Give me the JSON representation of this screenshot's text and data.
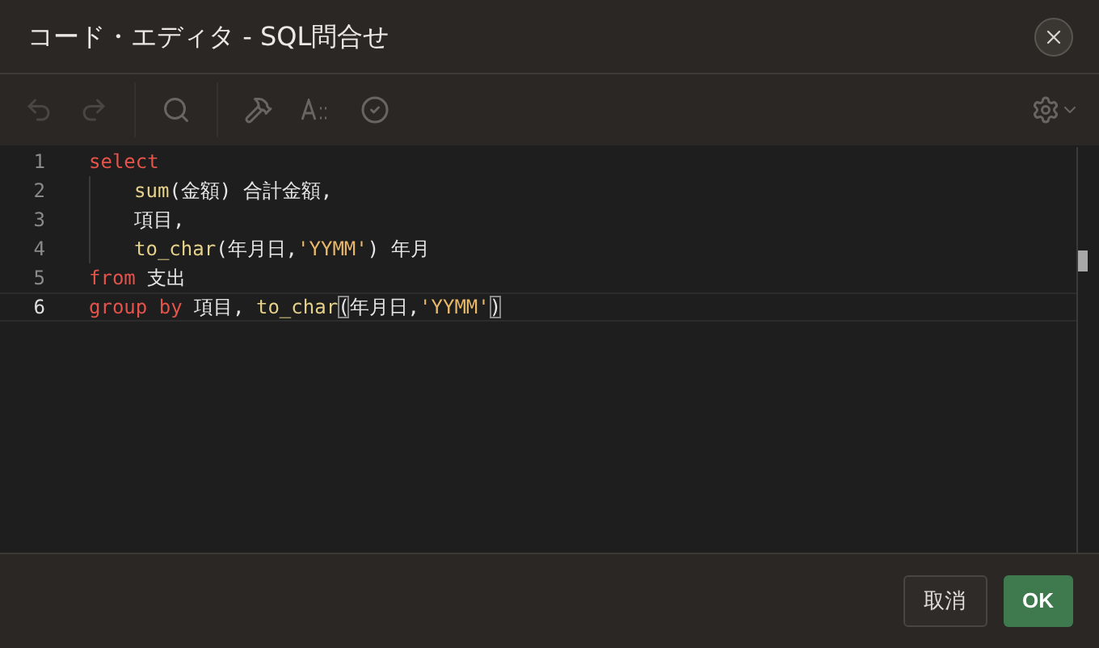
{
  "window": {
    "title": "コード・エディタ - SQL問合せ"
  },
  "toolbar": {
    "undo_disabled": true,
    "redo_disabled": true
  },
  "editor": {
    "lines": [
      {
        "number": "1",
        "active": false,
        "indent": false,
        "tokens": [
          {
            "kind": "keyword",
            "text": "select"
          }
        ]
      },
      {
        "number": "2",
        "active": false,
        "indent": true,
        "tokens": [
          {
            "kind": "function",
            "text": "sum"
          },
          {
            "kind": "plain",
            "text": "(金額) 合計金額,"
          }
        ]
      },
      {
        "number": "3",
        "active": false,
        "indent": true,
        "tokens": [
          {
            "kind": "plain",
            "text": "項目,"
          }
        ]
      },
      {
        "number": "4",
        "active": false,
        "indent": true,
        "tokens": [
          {
            "kind": "function",
            "text": "to_char"
          },
          {
            "kind": "plain",
            "text": "(年月日,"
          },
          {
            "kind": "string",
            "text": "'YYMM'"
          },
          {
            "kind": "plain",
            "text": ") 年月"
          }
        ]
      },
      {
        "number": "5",
        "active": false,
        "indent": false,
        "tokens": [
          {
            "kind": "keyword",
            "text": "from"
          },
          {
            "kind": "plain",
            "text": " 支出"
          }
        ]
      },
      {
        "number": "6",
        "active": true,
        "indent": false,
        "tokens": [
          {
            "kind": "keyword",
            "text": "group by"
          },
          {
            "kind": "plain",
            "text": " 項目, "
          },
          {
            "kind": "function",
            "text": "to_char"
          },
          {
            "kind": "bracket",
            "text": "("
          },
          {
            "kind": "plain",
            "text": "年月日,"
          },
          {
            "kind": "string",
            "text": "'YYMM'"
          },
          {
            "kind": "bracket",
            "text": ")"
          }
        ]
      }
    ]
  },
  "buttons": [
    {
      "label": "取消",
      "kind": "secondary"
    },
    {
      "label": "OK",
      "kind": "primary"
    }
  ]
}
